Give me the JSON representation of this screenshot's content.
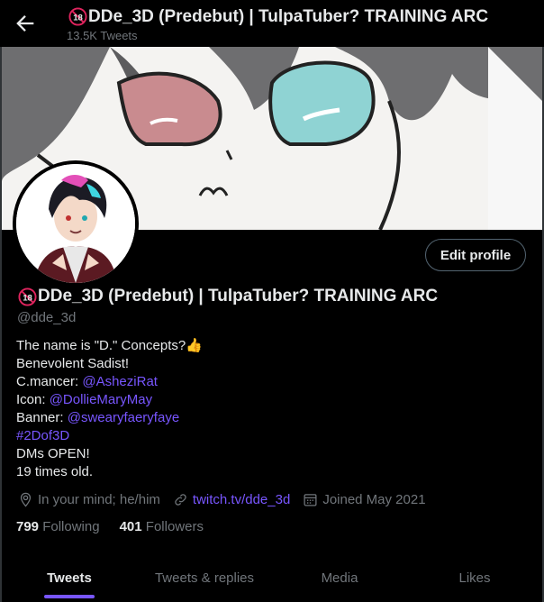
{
  "header": {
    "title": "DDe_3D (Predebut) | TulpaTuber? TRAINING ARC",
    "badge": "18",
    "tweet_count": "13.5K Tweets"
  },
  "profile": {
    "name": "DDe_3D (Predebut) | TulpaTuber? TRAINING ARC",
    "badge": "18",
    "handle": "@dde_3d",
    "edit_label": "Edit profile",
    "bio": {
      "line1": "The name is \"D.\"  Concepts?",
      "line1_emoji": "👍",
      "line2": "Benevolent Sadist!",
      "line3_prefix": "C.mancer: ",
      "line3_link": "@AsheziRat",
      "line4_prefix": "Icon: ",
      "line4_link": "@DollieMaryMay",
      "line5_prefix": "Banner: ",
      "line5_link": "@swearyfaeryfaye",
      "line6_link": "#2Dof3D",
      "line7": "DMs OPEN!",
      "line8": "19 times old."
    },
    "location": "In your mind; he/him",
    "website": "twitch.tv/dde_3d",
    "joined": "Joined May 2021",
    "following_count": "799",
    "following_label": "Following",
    "followers_count": "401",
    "followers_label": "Followers"
  },
  "tabs": [
    {
      "label": "Tweets",
      "active": true
    },
    {
      "label": "Tweets & replies",
      "active": false
    },
    {
      "label": "Media",
      "active": false
    },
    {
      "label": "Likes",
      "active": false
    }
  ],
  "colors": {
    "accent": "#7856ff",
    "muted": "#71767b",
    "text": "#e7e9ea",
    "background": "#000000"
  }
}
